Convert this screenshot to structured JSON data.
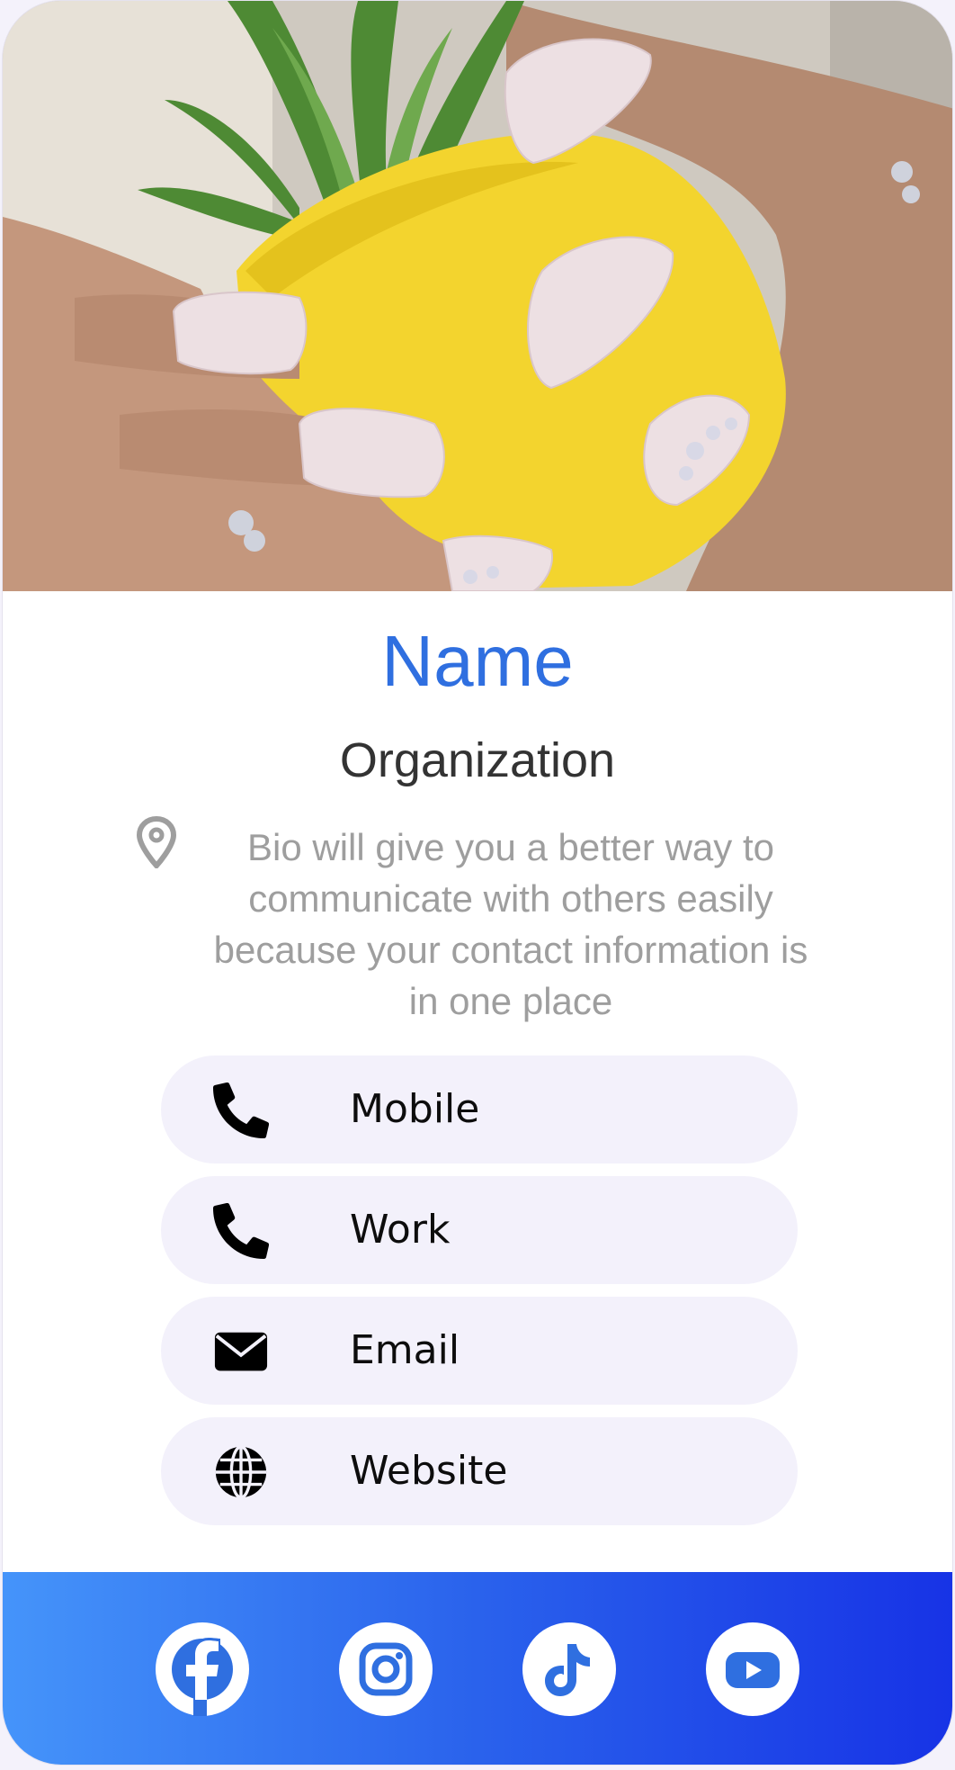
{
  "profile": {
    "name": "Name",
    "organization": "Organization",
    "bio": "Bio will give you a better way to communicate with others easily because your contact information is in one place"
  },
  "contacts": [
    {
      "label": "Mobile",
      "icon": "phone-icon"
    },
    {
      "label": "Work",
      "icon": "phone-icon"
    },
    {
      "label": "Email",
      "icon": "envelope-icon"
    },
    {
      "label": "Website",
      "icon": "globe-icon"
    }
  ],
  "social": [
    {
      "network": "Facebook",
      "icon": "facebook-icon"
    },
    {
      "network": "Instagram",
      "icon": "instagram-icon"
    },
    {
      "network": "TikTok",
      "icon": "tiktok-icon"
    },
    {
      "network": "YouTube",
      "icon": "youtube-icon"
    }
  ],
  "colors": {
    "accent": "#2f6fe0",
    "social_gradient_start": "#4594fa",
    "social_gradient_end": "#1733e6",
    "button_background": "#f3f1fb"
  }
}
